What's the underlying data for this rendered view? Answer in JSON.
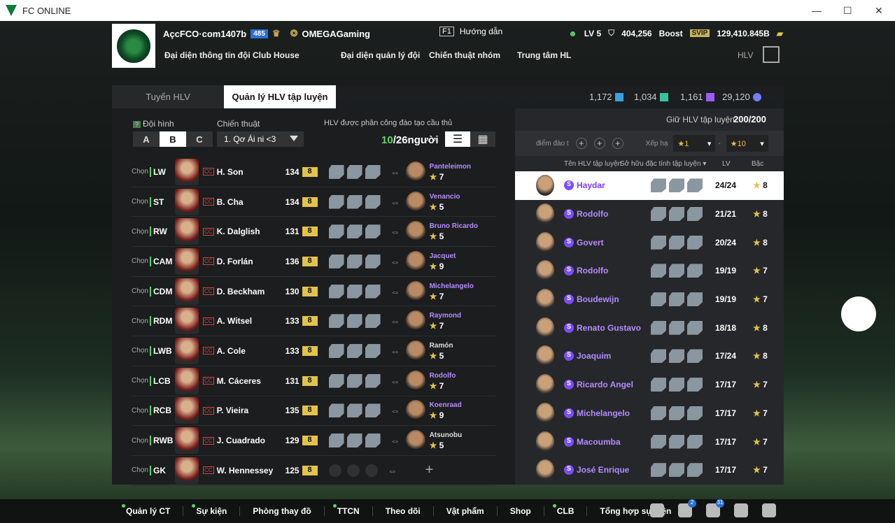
{
  "window": {
    "title": "FC ONLINE"
  },
  "account": {
    "name": "AçcFCO·com1407b",
    "badge": "485",
    "club": "OMEGAGaming"
  },
  "nav": [
    "Đại diện thông tin đội",
    "Club House",
    "Đại diện quản lý đội",
    "Chiến thuật nhóm",
    "Trung tâm HL"
  ],
  "help": {
    "key": "F1",
    "label": "Hướng dẫn"
  },
  "stats": {
    "lv": "LV 5",
    "tokens": "404,256",
    "boost": "Boost",
    "svip": "SVIP",
    "bp": "129,410.845B"
  },
  "hlv_label": "HLV",
  "tabs": [
    "Tuyển HLV",
    "Quản lý HLV tập luyện"
  ],
  "resources": [
    "1,172",
    "1,034",
    "1,161",
    "29,120"
  ],
  "keep": {
    "label": "Giữ HLV tập luyện",
    "value": "200/200"
  },
  "left": {
    "formation_label": "Đội hình",
    "tactic_label": "Chiến thuật",
    "tactic": "1. Qơ Ái ni <3",
    "assign_label": "HLV được phân công đào tạo cầu thủ",
    "count_current": "10",
    "count_total": "/26người",
    "formations": [
      "A",
      "B",
      "C"
    ],
    "rows": [
      {
        "chon": "Chọn",
        "pos": "LW",
        "name": "H. Son",
        "ovr": "134",
        "lvl": "8",
        "coach": "Panteleimon",
        "star": "7",
        "ic": [
          "7",
          "5",
          "5"
        ]
      },
      {
        "chon": "Chọn",
        "pos": "ST",
        "name": "B. Cha",
        "ovr": "134",
        "lvl": "8",
        "coach": "Venancio",
        "star": "5",
        "ic": [
          "4",
          "5",
          "5"
        ]
      },
      {
        "chon": "Chọn",
        "pos": "RW",
        "name": "K. Dalglish",
        "ovr": "131",
        "lvl": "8",
        "coach": "Bruno Ricardo",
        "star": "5",
        "ic": [
          "5",
          "5",
          "5"
        ]
      },
      {
        "chon": "Chọn",
        "pos": "CAM",
        "name": "D. Forlán",
        "ovr": "136",
        "lvl": "8",
        "coach": "Jacquet",
        "star": "9",
        "ic": [
          "9",
          "5",
          "5"
        ]
      },
      {
        "chon": "Chọn",
        "pos": "CDM",
        "name": "D. Beckham",
        "ovr": "130",
        "lvl": "8",
        "coach": "Michelangelo",
        "star": "7",
        "ic": [
          "7",
          "5",
          "5"
        ]
      },
      {
        "chon": "Chọn",
        "pos": "RDM",
        "name": "A. Witsel",
        "ovr": "133",
        "lvl": "8",
        "coach": "Raymond",
        "star": "7",
        "ic": [
          "7",
          "5",
          "5"
        ]
      },
      {
        "chon": "Chọn",
        "pos": "LWB",
        "name": "A. Cole",
        "ovr": "133",
        "lvl": "8",
        "coach": "Ramón",
        "star": "5",
        "ic": [
          "5",
          "5",
          "5"
        ],
        "plain": true
      },
      {
        "chon": "Chọn",
        "pos": "LCB",
        "name": "M. Cáceres",
        "ovr": "131",
        "lvl": "8",
        "coach": "Rodolfo",
        "star": "7",
        "ic": [
          "7",
          "5",
          "5"
        ]
      },
      {
        "chon": "Chọn",
        "pos": "RCB",
        "name": "P. Vieira",
        "ovr": "135",
        "lvl": "8",
        "coach": "Koenraad",
        "star": "9",
        "ic": [
          "9",
          "5",
          "5"
        ]
      },
      {
        "chon": "Chọn",
        "pos": "RWB",
        "name": "J. Cuadrado",
        "ovr": "129",
        "lvl": "8",
        "coach": "Atsunobu",
        "star": "5",
        "ic": [
          "5",
          "6",
          "5"
        ],
        "plain": true
      },
      {
        "chon": "Chọn",
        "pos": "GK",
        "name": "W. Hennessey",
        "ovr": "125",
        "lvl": "8",
        "coach": "",
        "star": "",
        "ic": [],
        "empty": true
      }
    ]
  },
  "right": {
    "filter_label": "điểm đào t",
    "rank_label": "Xếp hạ",
    "rank_min": "★1",
    "rank_max": "★10",
    "dash": "-",
    "head": {
      "name": "Tên HLV tập luyện",
      "own": "Sở hữu đặc tính tập luyện ▾",
      "lv": "LV",
      "bac": "Bậc"
    },
    "rows": [
      {
        "name": "Haydar",
        "lv": "24/24",
        "bac": "8",
        "ic": [
          "8",
          "8",
          "8"
        ]
      },
      {
        "name": "Rodolfo",
        "lv": "21/21",
        "bac": "8",
        "ic": [
          "8",
          "8",
          "5"
        ]
      },
      {
        "name": "Govert",
        "lv": "20/24",
        "bac": "8",
        "ic": [
          "7",
          "6",
          "7"
        ]
      },
      {
        "name": "Rodolfo",
        "lv": "19/19",
        "bac": "7",
        "ic": [
          "7",
          "7",
          "5"
        ]
      },
      {
        "name": "Boudewijn",
        "lv": "19/19",
        "bac": "7",
        "ic": [
          "7",
          "7",
          "5"
        ]
      },
      {
        "name": "Renato Gustavo",
        "lv": "18/18",
        "bac": "8",
        "ic": [
          "8",
          "5",
          "5"
        ]
      },
      {
        "name": "Joaquim",
        "lv": "17/24",
        "bac": "8",
        "ic": [
          "5",
          "5",
          "6"
        ]
      },
      {
        "name": "Ricardo Angel",
        "lv": "17/17",
        "bac": "7",
        "ic": [
          "7",
          "5",
          "5"
        ]
      },
      {
        "name": "Michelangelo",
        "lv": "17/17",
        "bac": "7",
        "ic": [
          "7",
          "5",
          "5"
        ]
      },
      {
        "name": "Macoumba",
        "lv": "17/17",
        "bac": "7",
        "ic": [
          "7",
          "5",
          "5"
        ]
      },
      {
        "name": "José Enrique",
        "lv": "17/17",
        "bac": "7",
        "ic": [
          "7",
          "5",
          "5"
        ]
      }
    ]
  },
  "bottom": [
    "Quản lý CT",
    "Sự kiện",
    "Phòng thay đồ",
    "TTCN",
    "Theo dõi",
    "Vật phẩm",
    "Shop",
    "CLB",
    "Tổng hợp sự kiện"
  ],
  "notif": {
    "home": "2",
    "bell": "31"
  }
}
